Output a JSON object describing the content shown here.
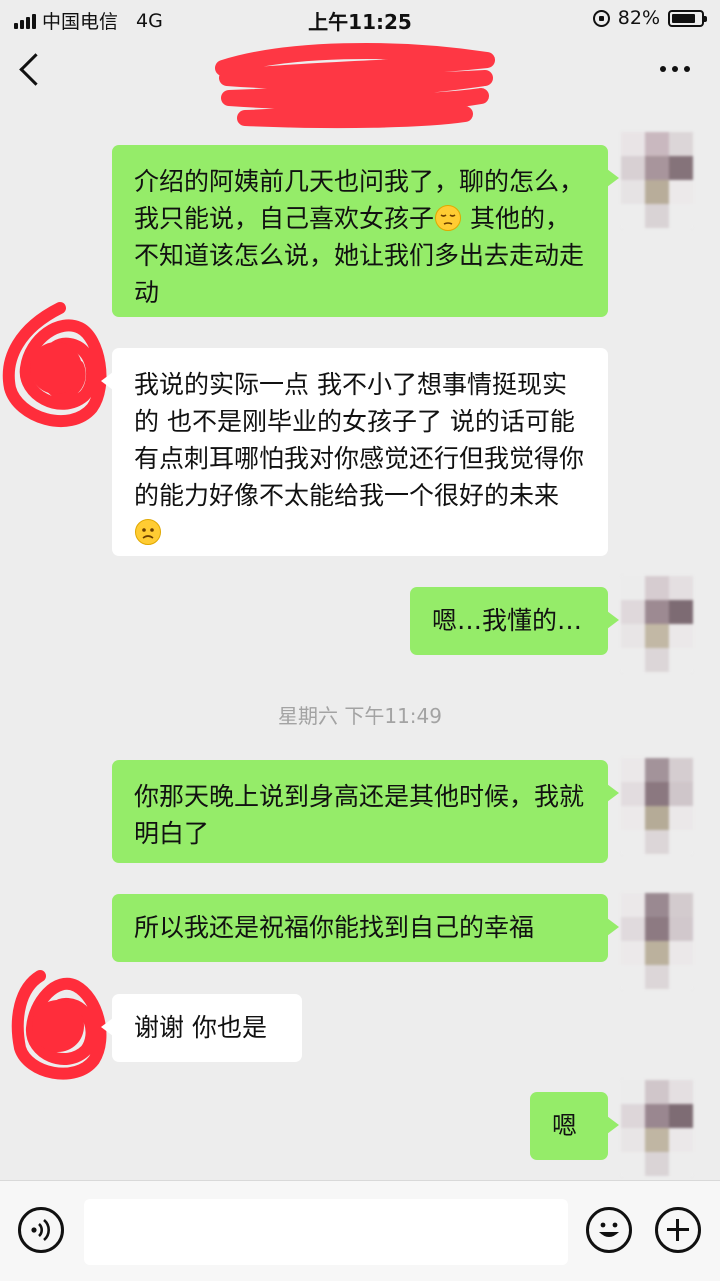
{
  "status_bar": {
    "carrier": "中国电信",
    "network": "4G",
    "time": "上午11:25",
    "battery": "82%",
    "battery_level": 0.82
  },
  "header": {
    "title": "",
    "back_icon": "chevron-left-icon",
    "more_icon": "more-dots-icon"
  },
  "messages": [
    {
      "side": "out",
      "text": "介绍的阿姨前几天也问我了，聊的怎么，我只能说，自己喜欢女孩子",
      "emoji": "pensive-face",
      "trailing": "其他的，不知道该怎么说，她让我们多出去走动走动"
    },
    {
      "side": "in",
      "text": "我说的实际一点 我不小了想事情挺现实的 也不是刚毕业的女孩子了 说的话可能有点刺耳哪怕我对你感觉还行但我觉得你的能力好像不太能给我一个很好的未来",
      "emoji": "worried-face"
    },
    {
      "side": "out",
      "text": "嗯…我懂的…"
    },
    {
      "side": "out",
      "text": "你那天晚上说到身高还是其他时候，我就明白了"
    },
    {
      "side": "out",
      "text": "所以我还是祝福你能找到自己的幸福"
    },
    {
      "side": "in",
      "text": "谢谢 你也是"
    },
    {
      "side": "out",
      "text": "嗯"
    }
  ],
  "timestamp": "星期六 下午11:49",
  "input_bar": {
    "voice_icon": "voice-icon",
    "emoji_icon": "emoji-icon",
    "plus_icon": "plus-icon",
    "input_value": ""
  },
  "colors": {
    "background": "#ededed",
    "outgoing_bubble": "#95ec69",
    "incoming_bubble": "#ffffff",
    "redaction": "#ff2d3b"
  }
}
